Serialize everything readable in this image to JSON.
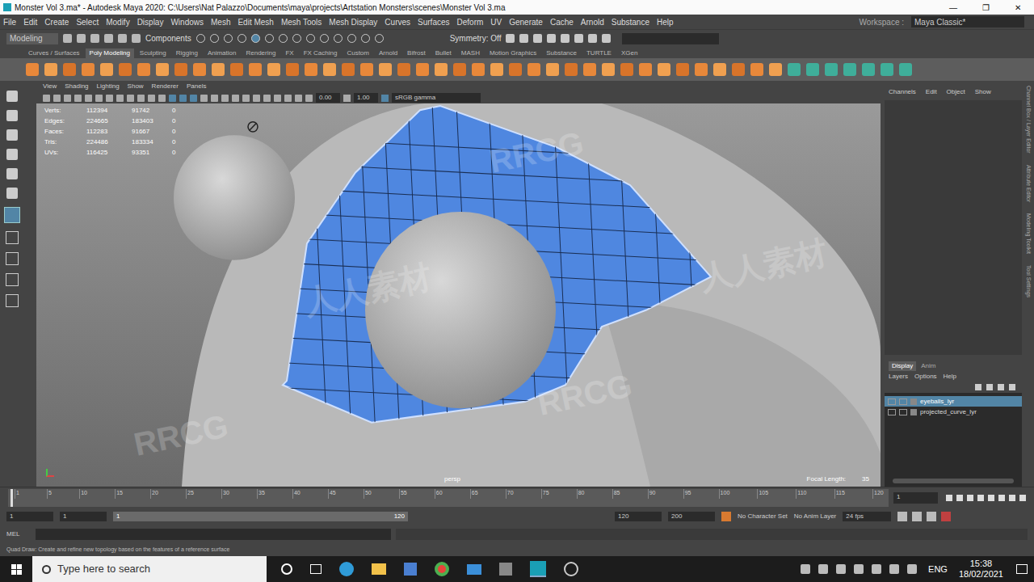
{
  "window": {
    "title": "Monster Vol 3.ma* - Autodesk Maya 2020: C:\\Users\\Nat Palazzo\\Documents\\maya\\projects\\Artstation Monsters\\scenes\\Monster Vol 3.ma",
    "controls": [
      "—",
      "❐",
      "✕"
    ]
  },
  "menu": [
    "File",
    "Edit",
    "Create",
    "Select",
    "Modify",
    "Display",
    "Windows",
    "Mesh",
    "Edit Mesh",
    "Mesh Tools",
    "Mesh Display",
    "Curves",
    "Surfaces",
    "Deform",
    "UV",
    "Generate",
    "Cache",
    "Arnold",
    "Substance",
    "Help"
  ],
  "workspace": {
    "label": "Workspace :",
    "value": "Maya Classic*"
  },
  "status_line": {
    "mode": "Modeling",
    "components": "Components",
    "symmetry": "Symmetry: Off"
  },
  "shelf": {
    "tabs": [
      {
        "label": "Curves / Surfaces",
        "selected": false
      },
      {
        "label": "Poly Modeling",
        "selected": true
      },
      {
        "label": "Sculpting",
        "selected": false
      },
      {
        "label": "Rigging",
        "selected": false
      },
      {
        "label": "Animation",
        "selected": false
      },
      {
        "label": "Rendering",
        "selected": false
      },
      {
        "label": "FX",
        "selected": false
      },
      {
        "label": "FX Caching",
        "selected": false
      },
      {
        "label": "Custom",
        "selected": false
      },
      {
        "label": "Arnold",
        "selected": false
      },
      {
        "label": "Bifrost",
        "selected": false
      },
      {
        "label": "Bullet",
        "selected": false
      },
      {
        "label": "MASH",
        "selected": false
      },
      {
        "label": "Motion Graphics",
        "selected": false
      },
      {
        "label": "Substance",
        "selected": false
      },
      {
        "label": "TURTLE",
        "selected": false
      },
      {
        "label": "XGen",
        "selected": false
      }
    ]
  },
  "viewport": {
    "menu": [
      "View",
      "Shading",
      "Lighting",
      "Show",
      "Renderer",
      "Panels"
    ],
    "exposure": "0.00",
    "gamma": "1.00",
    "color_space": "sRGB gamma",
    "hud": [
      {
        "label": "Verts:",
        "values": [
          "112394",
          "91742",
          "0"
        ]
      },
      {
        "label": "Edges:",
        "values": [
          "224665",
          "183403",
          "0"
        ]
      },
      {
        "label": "Faces:",
        "values": [
          "112283",
          "91667",
          "0"
        ]
      },
      {
        "label": "Tris:",
        "values": [
          "224486",
          "183334",
          "0"
        ]
      },
      {
        "label": "UVs:",
        "values": [
          "116425",
          "93351",
          "0"
        ]
      }
    ],
    "camera": "persp",
    "focal_length_label": "Focal Length:",
    "focal_length": "35"
  },
  "channel_box": {
    "menu": [
      "Channels",
      "Edit",
      "Object",
      "Show"
    ]
  },
  "layer_editor": {
    "tabs": [
      {
        "label": "Display",
        "selected": true
      },
      {
        "label": "Anim",
        "selected": false
      }
    ],
    "menu": [
      "Layers",
      "Options",
      "Help"
    ],
    "layers": [
      {
        "name": "eyeballs_lyr",
        "selected": true
      },
      {
        "name": "projected_curve_lyr",
        "selected": false
      }
    ]
  },
  "side_tabs": [
    "Channel Box / Layer Editor",
    "Attribute Editor",
    "Modeling Toolkit",
    "Tool Settings"
  ],
  "time_slider": {
    "ticks": [
      "1",
      "5",
      "10",
      "15",
      "20",
      "25",
      "30",
      "35",
      "40",
      "45",
      "50",
      "55",
      "60",
      "65",
      "70",
      "75",
      "80",
      "85",
      "90",
      "95",
      "100",
      "105",
      "110",
      "115",
      "120"
    ],
    "current": "1"
  },
  "range": {
    "start": "1",
    "range_start": "1",
    "handle_start": "1",
    "handle_end": "120",
    "range_end": "120",
    "end": "200",
    "character_set": "No Character Set",
    "anim_layer": "No Anim Layer",
    "fps": "24 fps"
  },
  "command_line": {
    "language": "MEL"
  },
  "help_line": "Quad Draw: Create and refine new topology based on the features of a reference surface",
  "taskbar": {
    "search_placeholder": "Type here to search",
    "language": "ENG",
    "time": "15:38",
    "date": "18/02/2021"
  },
  "watermarks": [
    "RRCG",
    "人人素材",
    "RRCG",
    "人人素材",
    "RRCG"
  ]
}
